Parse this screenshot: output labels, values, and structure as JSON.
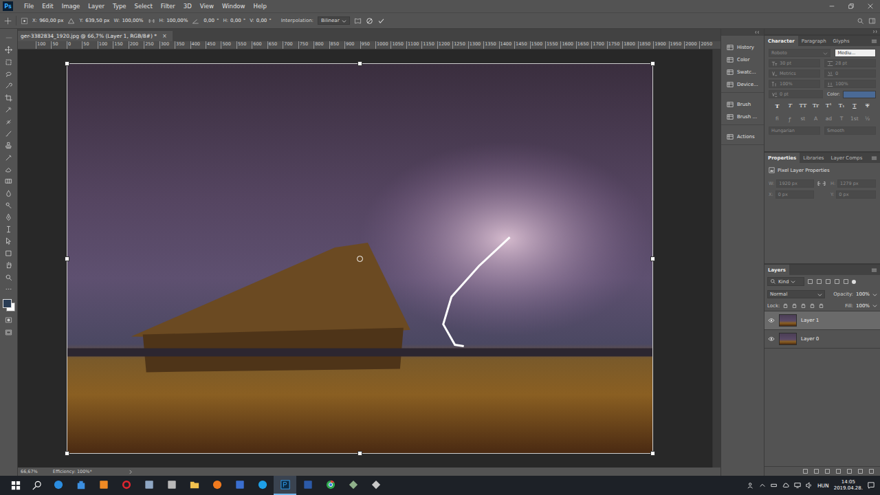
{
  "app": {
    "logo": "Ps"
  },
  "menu": [
    "File",
    "Edit",
    "Image",
    "Layer",
    "Type",
    "Select",
    "Filter",
    "3D",
    "View",
    "Window",
    "Help"
  ],
  "options_bar": {
    "fields": [
      {
        "kind": "x",
        "label": "X:",
        "value": "960,00 px",
        "unit": ""
      },
      {
        "kind": "y",
        "label": "Y:",
        "value": "639,50 px",
        "unit": ""
      },
      {
        "kind": "w",
        "label": "W:",
        "value": "100,00%",
        "unit": ""
      },
      {
        "kind": "h",
        "label": "H:",
        "value": "100,00%",
        "unit": ""
      },
      {
        "kind": "angle",
        "label": "",
        "value": "0,00",
        "unit": "°"
      },
      {
        "kind": "skew",
        "label": "H:",
        "value": "0,00",
        "unit": "°"
      },
      {
        "kind": "skew",
        "label": "V:",
        "value": "0,00",
        "unit": "°"
      }
    ],
    "interpolation_label": "Interpolation:",
    "interpolation": "Bilinear"
  },
  "document_tab": {
    "title": "ger-3382834_1920.jpg @ 66,7% (Layer 1, RGB/8#) *",
    "close": "×",
    "selected": true
  },
  "ruler": {
    "ticks": [
      "100",
      "50",
      "0",
      "50",
      "100",
      "150",
      "200",
      "250",
      "300",
      "350",
      "400",
      "450",
      "500",
      "550",
      "600",
      "650",
      "700",
      "750",
      "800",
      "850",
      "900",
      "950",
      "1000",
      "1050",
      "1100",
      "1150",
      "1200",
      "1250",
      "1300",
      "1350",
      "1400",
      "1450",
      "1500",
      "1550",
      "1600",
      "1650",
      "1700",
      "1750",
      "1800",
      "1850",
      "1900",
      "1950",
      "2000",
      "2050"
    ]
  },
  "status_bar": {
    "zoom": "66,67%",
    "info": "Efficiency: 100%*"
  },
  "dock": {
    "groups": [
      [
        "History",
        "Color",
        "Swatc...",
        "Device..."
      ],
      [
        "Brush",
        "Brush ..."
      ],
      [
        "Actions"
      ]
    ]
  },
  "character_panel": {
    "tabs": [
      {
        "label": "Character",
        "selected": true
      },
      {
        "label": "Paragraph",
        "selected": false
      },
      {
        "label": "Glyphs",
        "selected": false
      }
    ],
    "font_family": "Roboto",
    "font_style": "Mediu...",
    "size": "30 pt",
    "leading": "28 pt",
    "kerning": "Metrics",
    "tracking": "0",
    "vertical_scale": "100%",
    "horizontal_scale": "100%",
    "baseline_shift": "0 pt",
    "color_label": "Color:",
    "style_buttons": [
      {
        "label": "T",
        "kind": "bold"
      },
      {
        "label": "T",
        "kind": "italic"
      },
      {
        "label": "TT",
        "kind": "plain"
      },
      {
        "label": "Tr",
        "kind": "plain"
      },
      {
        "label": "T¹",
        "kind": "plain"
      },
      {
        "label": "T₁",
        "kind": "plain"
      },
      {
        "label": "T",
        "kind": "underline"
      },
      {
        "label": "T",
        "kind": "strike"
      }
    ],
    "opentype_buttons": [
      "fi",
      "ꝭ",
      "st",
      "A",
      "ad",
      "T",
      "1st",
      "½"
    ],
    "language": "Hungarian",
    "antialiasing": "Smooth",
    "disabled": true
  },
  "properties_panel": {
    "tabs": [
      {
        "label": "Properties",
        "selected": true
      },
      {
        "label": "Libraries",
        "selected": false
      },
      {
        "label": "Layer Comps",
        "selected": false
      }
    ],
    "title": "Pixel Layer Properties",
    "fields": [
      {
        "label": "W:",
        "value": "1920 px"
      },
      {
        "label": "H:",
        "value": "1279 px"
      },
      {
        "label": "X:",
        "value": "0 px"
      },
      {
        "label": "Y:",
        "value": "0 px"
      }
    ],
    "disabled": true
  },
  "layers_panel": {
    "title": "Layers",
    "filter": "Kind",
    "blend_mode": "Normal",
    "opacity_label": "Opacity:",
    "opacity": "100%",
    "lock_label": "Lock:",
    "fill_label": "Fill:",
    "fill": "100%",
    "layers": [
      {
        "name": "Layer 1",
        "visible": true,
        "selected": true
      },
      {
        "name": "Layer 0",
        "visible": true,
        "selected": false
      }
    ]
  },
  "taskbar": {
    "apps": [
      {
        "running": false,
        "selected": false
      },
      {
        "running": false,
        "selected": false
      },
      {
        "running": false,
        "selected": false
      },
      {
        "running": false,
        "selected": false
      },
      {
        "running": false,
        "selected": false
      },
      {
        "running": false,
        "selected": false
      },
      {
        "running": false,
        "selected": false
      },
      {
        "running": false,
        "selected": false
      },
      {
        "running": false,
        "selected": false
      },
      {
        "running": false,
        "selected": false
      },
      {
        "running": true,
        "selected": true
      },
      {
        "running": false,
        "selected": false
      },
      {
        "running": false,
        "selected": false
      },
      {
        "running": false,
        "selected": false
      },
      {
        "running": false,
        "selected": false
      }
    ],
    "language": "HUN",
    "time": "14:05",
    "date": "2019.04.28."
  }
}
